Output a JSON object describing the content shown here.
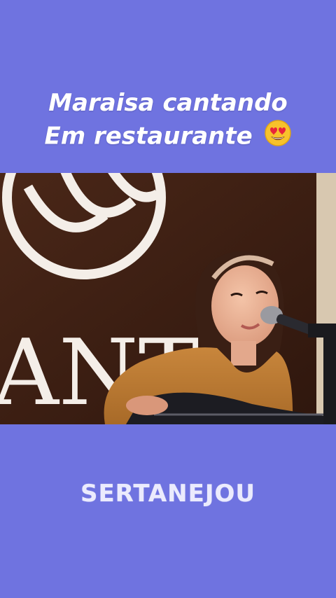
{
  "caption": {
    "line1": "Maraisa cantando",
    "line2": "Em restaurante"
  },
  "emoji_icon": "heart-eyes-emoji",
  "video": {
    "sign_text": "ANT"
  },
  "watermark": {
    "text": "SERTANEJOU"
  },
  "colors": {
    "background": "#6f73e0",
    "caption_text": "#ffffff"
  }
}
